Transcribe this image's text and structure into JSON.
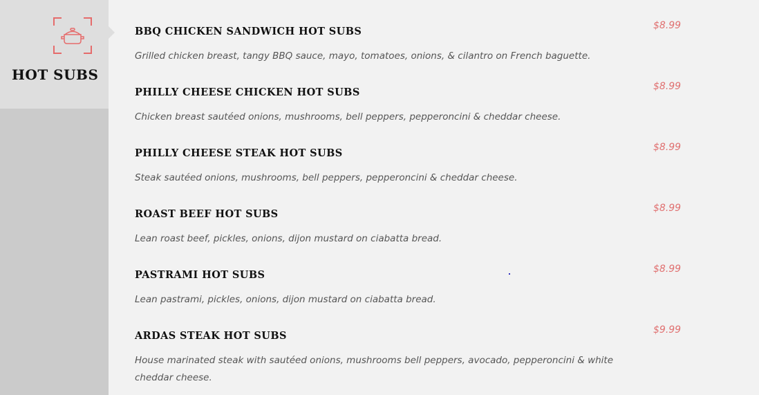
{
  "category": {
    "title": "HOT SUBS",
    "icon": "cooking-pot-icon",
    "accent_color": "#e56b6b"
  },
  "items": [
    {
      "name": "BBQ CHICKEN SANDWICH HOT SUBS",
      "description": "Grilled chicken breast, tangy BBQ sauce, mayo, tomatoes, onions, & cilantro on French baguette.",
      "price": "$8.99"
    },
    {
      "name": "PHILLY CHEESE CHICKEN HOT SUBS",
      "description": "Chicken breast sautéed onions, mushrooms, bell peppers, pepperoncini & cheddar cheese.",
      "price": "$8.99"
    },
    {
      "name": "PHILLY CHEESE STEAK HOT SUBS",
      "description": "Steak sautéed onions, mushrooms, bell peppers, pepperoncini & cheddar cheese.",
      "price": "$8.99"
    },
    {
      "name": "ROAST BEEF HOT SUBS",
      "description": "Lean roast beef, pickles, onions, dijon mustard on ciabatta bread.",
      "price": "$8.99"
    },
    {
      "name": "PASTRAMI HOT SUBS",
      "description": "Lean pastrami, pickles, onions, dijon mustard on ciabatta bread.",
      "price": "$8.99"
    },
    {
      "name": "ARDAS STEAK HOT SUBS",
      "description": "House marinated steak with sautéed onions, mushrooms bell peppers, avocado, pepperoncini & white cheddar cheese.",
      "price": "$9.99"
    }
  ]
}
